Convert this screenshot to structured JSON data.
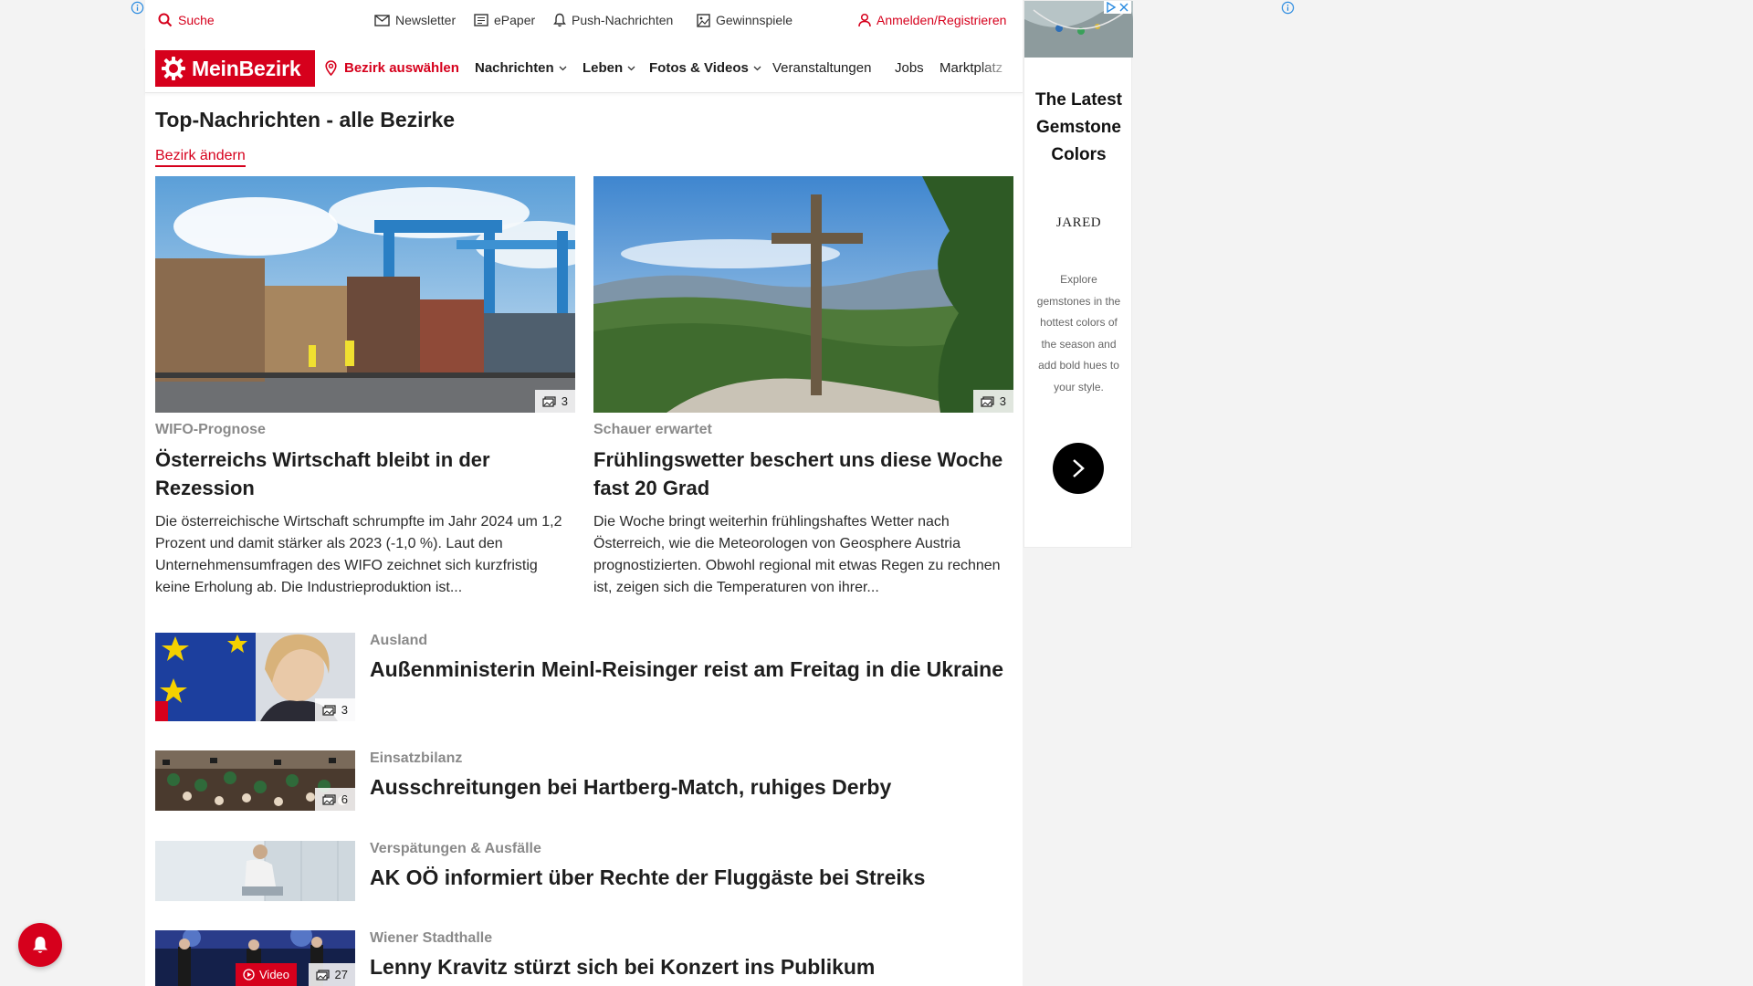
{
  "topbar": {
    "search": "Suche",
    "newsletter": "Newsletter",
    "epaper": "ePaper",
    "push": "Push-Nachrichten",
    "contests": "Gewinnspiele",
    "login": "Anmelden/Registrieren"
  },
  "nav": {
    "logo": "MeinBezirk",
    "district_select": "Bezirk auswählen",
    "items": [
      "Nachrichten",
      "Leben",
      "Fotos & Videos",
      "Veranstaltungen",
      "Jobs",
      "Marktplatz"
    ]
  },
  "section": {
    "title": "Top-Nachrichten - alle Bezirke",
    "change_district": "Bezirk ändern"
  },
  "featured": [
    {
      "kicker": "WIFO-Prognose",
      "headline": "Österreichs Wirtschaft bleibt in der Rezession",
      "teaser": "Die österreichische Wirtschaft schrumpfte im Jahr 2024 um 1,2 Prozent und damit stärker als 2023 (-1,0 %). Laut den Unternehmensumfragen des WIFO zeichnet sich kurzfristig keine Erholung ab. Die Industrieproduktion ist...",
      "photos": "3"
    },
    {
      "kicker": "Schauer erwartet",
      "headline": "Frühlingswetter beschert uns diese Woche fast 20 Grad",
      "teaser": "Die Woche bringt weiterhin frühlingshaftes Wetter nach Österreich, wie die Meteorologen von Geosphere Austria prognostizierten. Obwohl regional mit etwas Regen zu rechnen ist, zeigen sich die Temperaturen von ihrer...",
      "photos": "3"
    }
  ],
  "articles": [
    {
      "kicker": "Ausland",
      "headline": "Außenministerin Meinl-Reisinger reist am Freitag in die Ukraine",
      "photos": "3"
    },
    {
      "kicker": "Einsatzbilanz",
      "headline": "Ausschreitungen bei Hartberg-Match, ruhiges Derby",
      "photos": "6"
    },
    {
      "kicker": "Verspätungen & Ausfälle",
      "headline": "AK OÖ informiert über Rechte der Fluggäste bei Streiks"
    },
    {
      "kicker": "Wiener Stadthalle",
      "headline": "Lenny Kravitz stürzt sich bei Konzert ins Publikum",
      "video_label": "Video",
      "photos": "27"
    }
  ],
  "ad": {
    "title": "The Latest Gemstone Colors",
    "brand": "JARED",
    "body": "Explore gemstones in the hottest colors of the season and add bold hues to your style."
  },
  "colors": {
    "brand_red": "#d6001c"
  }
}
